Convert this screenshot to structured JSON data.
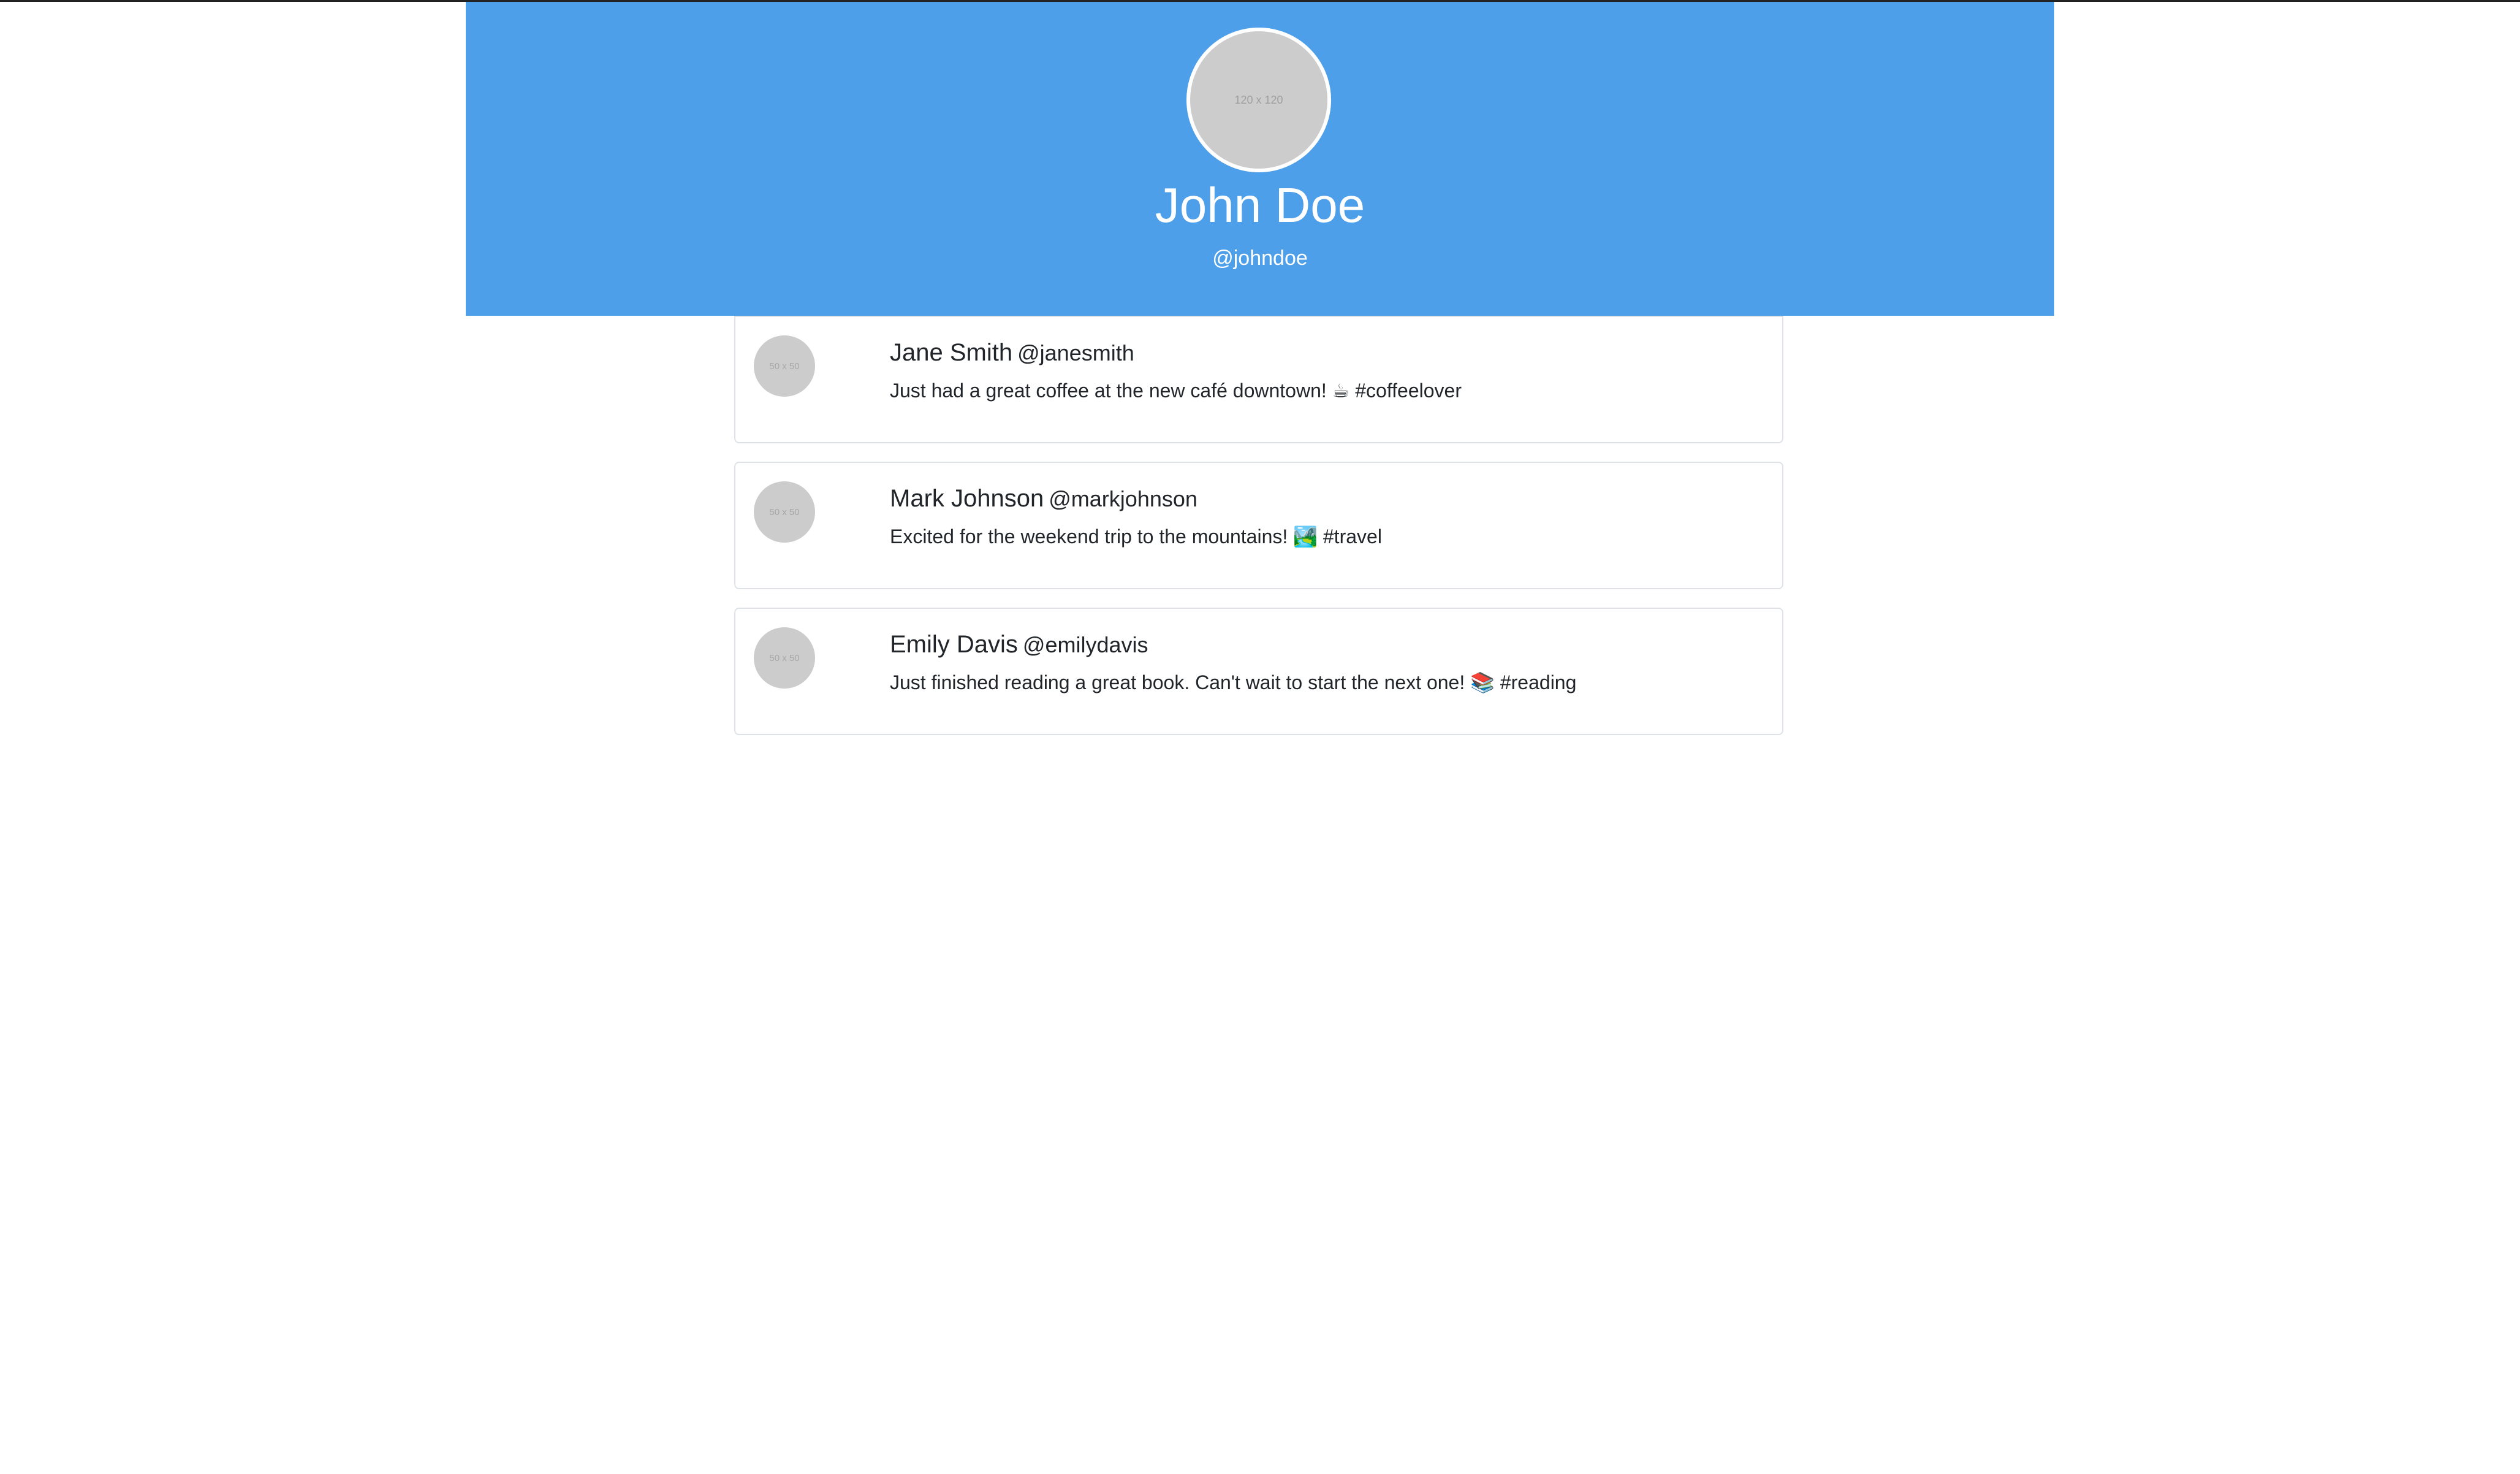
{
  "profile": {
    "avatar_placeholder": "120 x 120",
    "name": "John Doe",
    "handle": "@johndoe"
  },
  "colors": {
    "header_bg": "#4e9fea",
    "avatar_placeholder": "#cccccc"
  },
  "posts": [
    {
      "avatar_placeholder": "50 x 50",
      "name": "Jane Smith",
      "handle": "@janesmith",
      "text": "Just had a great coffee at the new café downtown! ☕ #coffeelover"
    },
    {
      "avatar_placeholder": "50 x 50",
      "name": "Mark Johnson",
      "handle": "@markjohnson",
      "text": "Excited for the weekend trip to the mountains! 🏞️ #travel"
    },
    {
      "avatar_placeholder": "50 x 50",
      "name": "Emily Davis",
      "handle": "@emilydavis",
      "text": "Just finished reading a great book. Can't wait to start the next one! 📚 #reading"
    }
  ]
}
